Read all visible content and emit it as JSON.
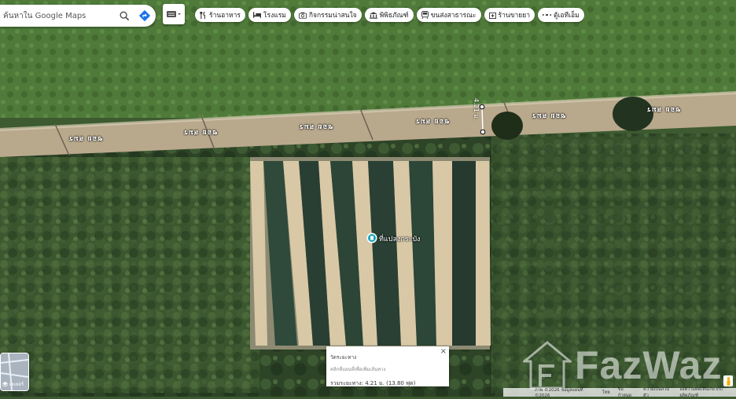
{
  "search": {
    "placeholder": "ค้นหาใน Google Maps"
  },
  "chips": [
    {
      "label": "ร้านอาหาร",
      "icon": "restaurant-icon"
    },
    {
      "label": "โรงแรม",
      "icon": "hotel-icon"
    },
    {
      "label": "กิจกรรมน่าสนใจ",
      "icon": "camera-icon"
    },
    {
      "label": "พิพิธภัณฑ์",
      "icon": "museum-icon"
    },
    {
      "label": "ขนส่งสาธารณะ",
      "icon": "transit-icon"
    },
    {
      "label": "ร้านขายยา",
      "icon": "pharmacy-icon"
    },
    {
      "label": "ตู้เอทีเอ็ม",
      "icon": "atm-icon"
    }
  ],
  "road_name": "ซอย สมร",
  "measure_label": "4.21 ม.",
  "place_pin": {
    "label": "ที่แปลงกระบัง"
  },
  "measure_popup": {
    "title": "วัดระยะทาง",
    "hint": "คลิกที่แผนที่เพื่อเพิ่มเส้นทาง",
    "total": "รวมระยะทาง: 4.21 ม. (13.80 ฟุต)"
  },
  "minimap": {
    "label": "เลเยอร์"
  },
  "watermark": "FazWaz",
  "footer": {
    "imagery": "ภาพ ©2026 ข้อมูลแผนที่ ©2026",
    "country": "ไทย",
    "terms": "ข้อกำหนด",
    "privacy": "ความเป็นส่วนตัว",
    "feedback": "ส่งความคิดเห็นเกี่ยวกับผลิตภัณฑ์"
  },
  "colors": {
    "pin": "#1aa3b8",
    "directions": "#1a73e8"
  }
}
